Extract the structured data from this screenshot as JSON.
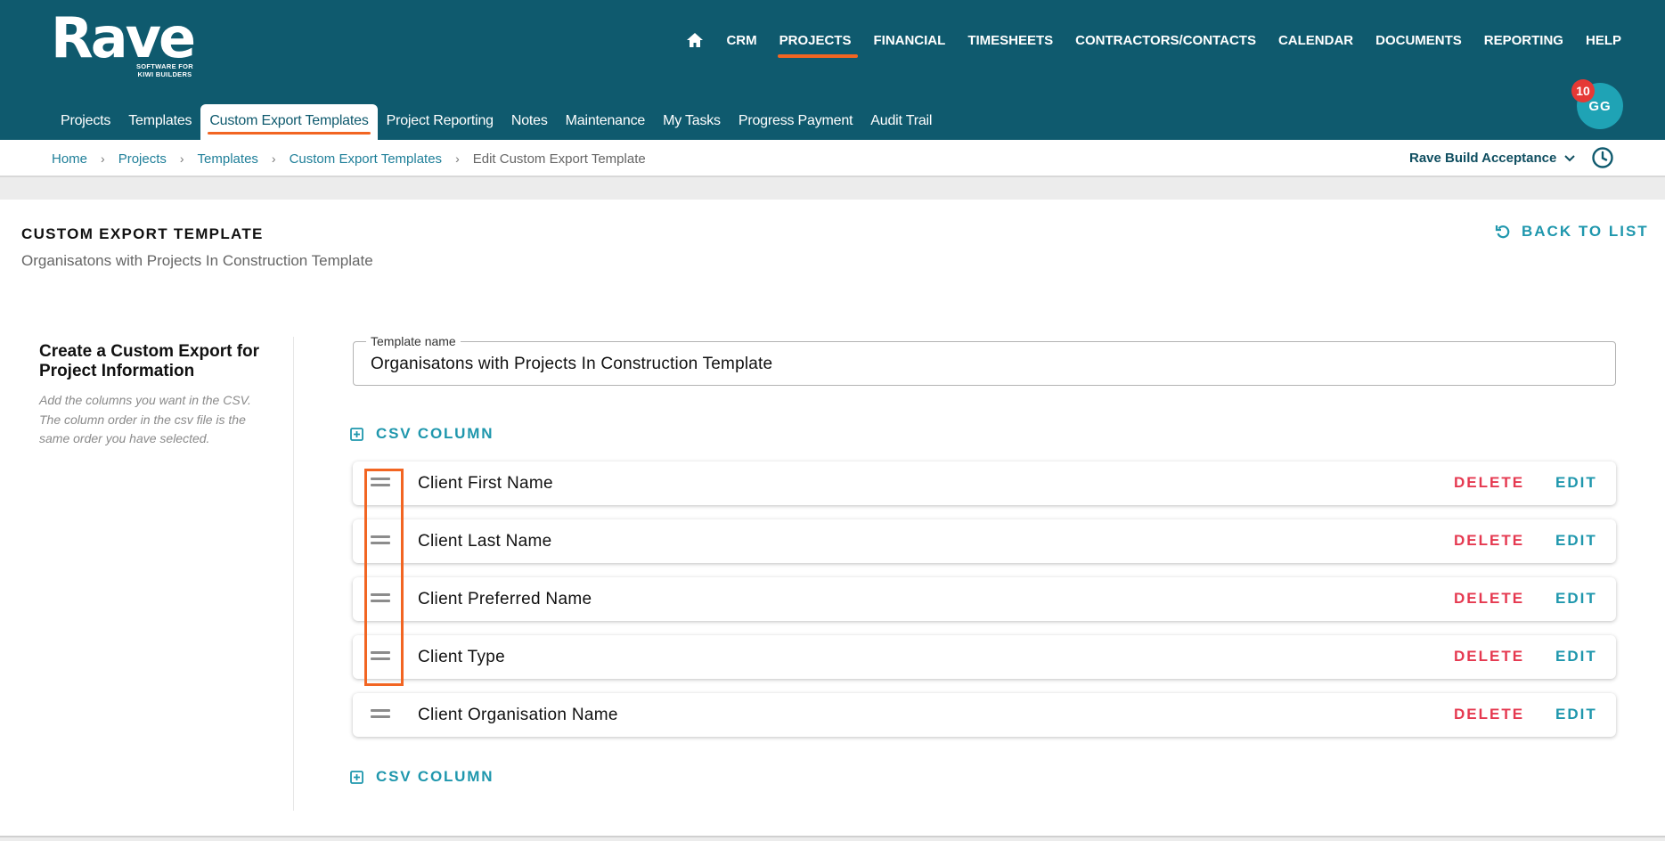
{
  "brand": {
    "name": "Rave",
    "tagline_line1": "SOFTWARE FOR",
    "tagline_line2": "KIWI BUILDERS"
  },
  "main_nav": [
    {
      "label": "CRM",
      "active": false
    },
    {
      "label": "PROJECTS",
      "active": true
    },
    {
      "label": "FINANCIAL",
      "active": false
    },
    {
      "label": "TIMESHEETS",
      "active": false
    },
    {
      "label": "CONTRACTORS/CONTACTS",
      "active": false
    },
    {
      "label": "CALENDAR",
      "active": false
    },
    {
      "label": "DOCUMENTS",
      "active": false
    },
    {
      "label": "REPORTING",
      "active": false
    },
    {
      "label": "HELP",
      "active": false
    }
  ],
  "user": {
    "initials": "GG",
    "notification_count": "10"
  },
  "sub_nav": [
    {
      "label": "Projects",
      "active": false
    },
    {
      "label": "Templates",
      "active": false
    },
    {
      "label": "Custom Export Templates",
      "active": true
    },
    {
      "label": "Project Reporting",
      "active": false
    },
    {
      "label": "Notes",
      "active": false
    },
    {
      "label": "Maintenance",
      "active": false
    },
    {
      "label": "My Tasks",
      "active": false
    },
    {
      "label": "Progress Payment",
      "active": false
    },
    {
      "label": "Audit Trail",
      "active": false
    }
  ],
  "breadcrumb": [
    "Home",
    "Projects",
    "Templates",
    "Custom Export Templates",
    "Edit Custom Export Template"
  ],
  "organisation": "Rave Build Acceptance",
  "page": {
    "title": "CUSTOM EXPORT TEMPLATE",
    "subtitle": "Organisatons with Projects In Construction Template",
    "back_label": "BACK TO LIST"
  },
  "sidebar": {
    "heading": "Create a Custom Export for Project Information",
    "help": "Add the columns you want in the CSV. The column order in the csv file is the same order you have selected."
  },
  "template_field": {
    "label": "Template name",
    "value": "Organisatons with Projects In Construction Template"
  },
  "add_column_label": "CSV COLUMN",
  "columns": [
    {
      "label": "Client First Name"
    },
    {
      "label": "Client Last Name"
    },
    {
      "label": "Client Preferred Name"
    },
    {
      "label": "Client Type"
    },
    {
      "label": "Client Organisation Name"
    }
  ],
  "row_actions": {
    "delete": "DELETE",
    "edit": "EDIT"
  },
  "colors": {
    "header": "#0f5a6e",
    "accent": "#1f97ad",
    "highlight": "#f26522",
    "danger": "#e53950"
  }
}
